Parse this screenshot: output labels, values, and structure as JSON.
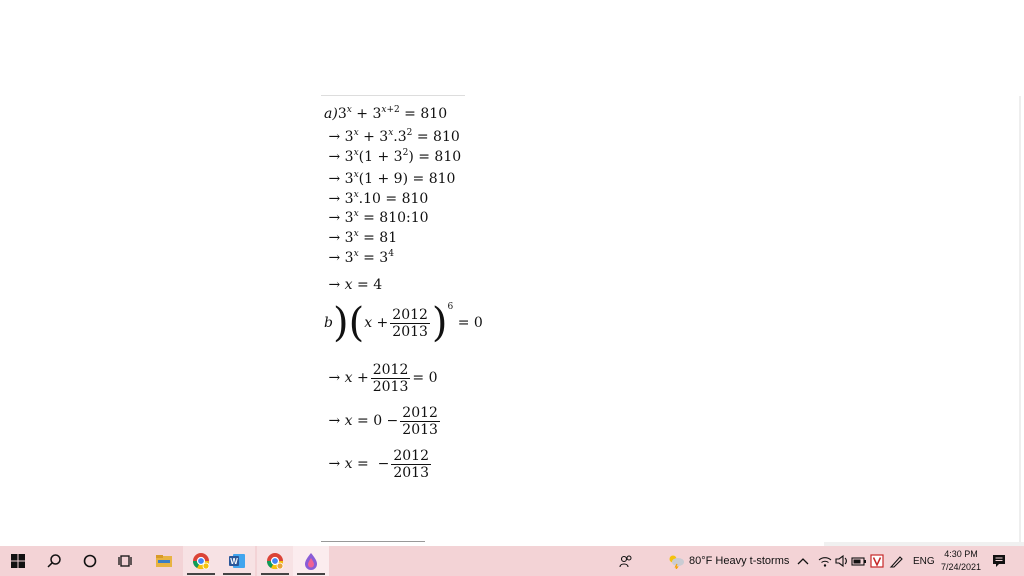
{
  "math": {
    "part_a_label": "a)",
    "part_b_label": "b",
    "arrow": "→",
    "lines_a": [
      "3x + 3x+2 = 810",
      "→ 3x + 3x.32 = 810",
      "→ 3x(1 + 32) = 810",
      "→ 3x(1 + 9) = 810",
      "→ 3x.10 = 810",
      "→ 3x = 810 : 10",
      "→ 3x = 81",
      "→ 3x = 34",
      "→ x = 4"
    ],
    "numbers": {
      "v810": "810",
      "v10": "10",
      "v81": "81",
      "v4": "4",
      "v9": "9",
      "v1": "1",
      "v3": "3",
      "v2": "2",
      "v6": "6",
      "v0": "0",
      "numerator": "2012",
      "denominator": "2013"
    }
  },
  "taskbar": {
    "weather": "80°F  Heavy t-storms",
    "language": "ENG",
    "time": "4:30 PM",
    "date": "7/24/2021",
    "apps": [
      {
        "name": "File Explorer",
        "color": "#e8a93a"
      },
      {
        "name": "Chrome",
        "color": "#3e8e41"
      },
      {
        "name": "Word",
        "color": "#2b579a"
      },
      {
        "name": "Chrome Profile",
        "color": "#3e8e41"
      },
      {
        "name": "Paint",
        "color": "#8a5cd6"
      }
    ]
  }
}
